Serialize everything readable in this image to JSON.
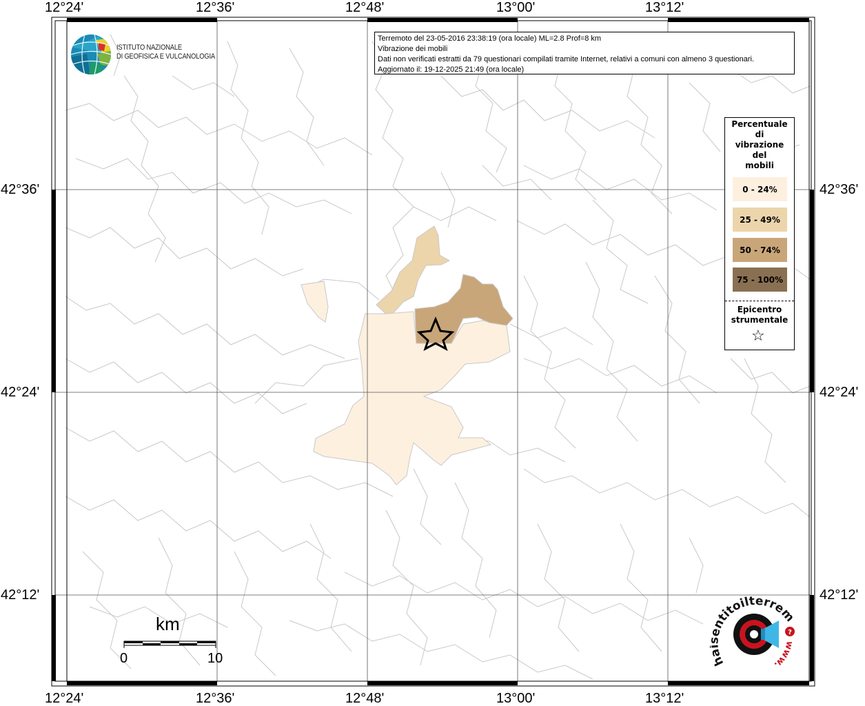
{
  "header": {
    "line1": "Terremoto del 23-05-2016 23:38:19 (ora locale) ML=2.8 Prof=8 km",
    "line2": "Vibrazione dei mobili",
    "line3": "Dati non verificati estratti da 79 questionari compilati tramite Internet, relativi a comuni con almeno 3 questionari.",
    "line4": "Aggiornato il: 19-12-2025 21:49 (ora locale)"
  },
  "logo": {
    "line1": "ISTITUTO NAZIONALE",
    "line2": "DI GEOFISICA E VULCANOLOGIA"
  },
  "axes": {
    "top": [
      "12°24'",
      "12°36'",
      "12°48'",
      "13°00'",
      "13°12'"
    ],
    "bottom": [
      "12°24'",
      "12°36'",
      "12°48'",
      "13°00'",
      "13°12'"
    ],
    "left": [
      "42°36'",
      "42°24'",
      "42°12'"
    ],
    "right": [
      "42°36'",
      "42°24'",
      "42°12'"
    ]
  },
  "legend": {
    "title_lines": [
      "Percentuale",
      "di",
      "vibrazione",
      "del",
      "mobili"
    ],
    "items": [
      {
        "label": "0 - 24%",
        "color": "#fdf0df"
      },
      {
        "label": "25 - 49%",
        "color": "#ecd5ab"
      },
      {
        "label": "50 - 74%",
        "color": "#c9a679"
      },
      {
        "label": "75 - 100%",
        "color": "#8a7052"
      }
    ],
    "epicenter_lines": [
      "Epicentro",
      "strumentale"
    ],
    "epicenter_symbol": "☆"
  },
  "scale": {
    "unit": "km",
    "start": "0",
    "end": "10"
  },
  "watermark": {
    "brand": "haisentitoilterremoto.it",
    "www": "www."
  }
}
